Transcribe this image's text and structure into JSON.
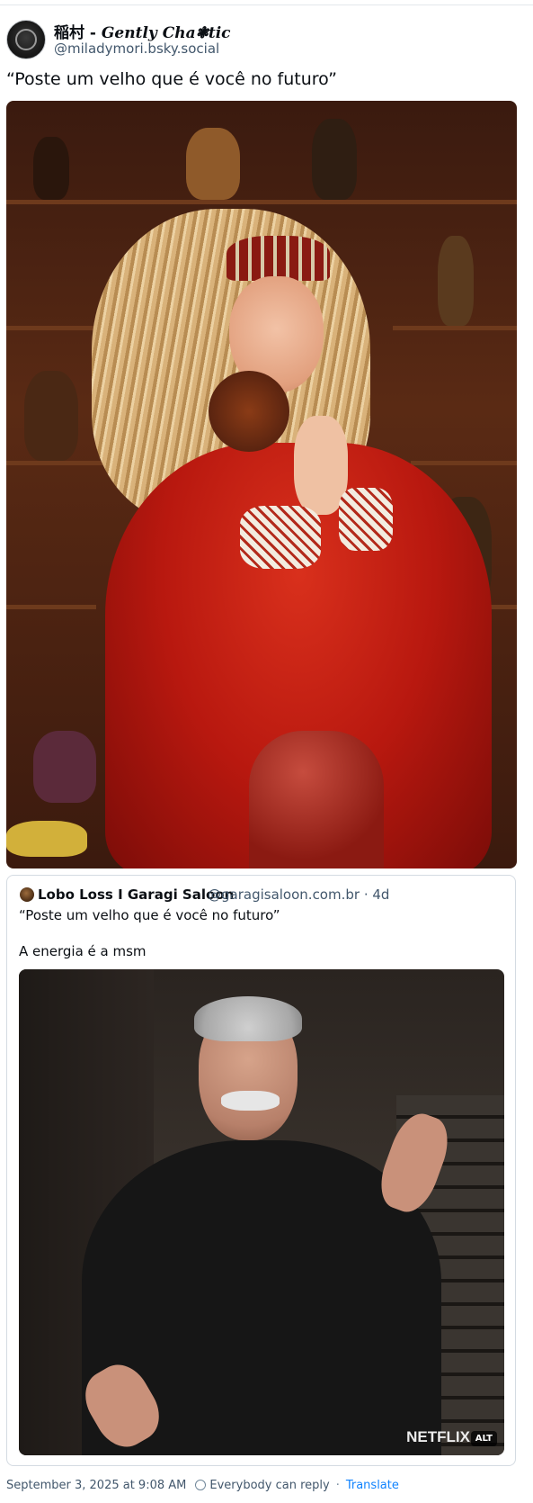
{
  "author": {
    "display_name_cjk": "稲村 - ",
    "display_name_fancy": "Gently Cha❃tic",
    "handle": "@miladymori.bsky.social"
  },
  "post": {
    "text": "“Poste um velho que é você no futuro”"
  },
  "quote": {
    "author_name": "Lobo Loss I Garagi Saloon",
    "author_handle": "@garagisaloon.com.br · 4d",
    "text_line1": "“Poste um velho que é você no futuro”",
    "text_line2": "A energia é a msm",
    "watermark": "NETFLIX",
    "alt_badge": "ALT"
  },
  "footer": {
    "timestamp": "September 3, 2025 at 9:08 AM",
    "reply_setting": "Everybody can reply",
    "translate": "Translate"
  }
}
